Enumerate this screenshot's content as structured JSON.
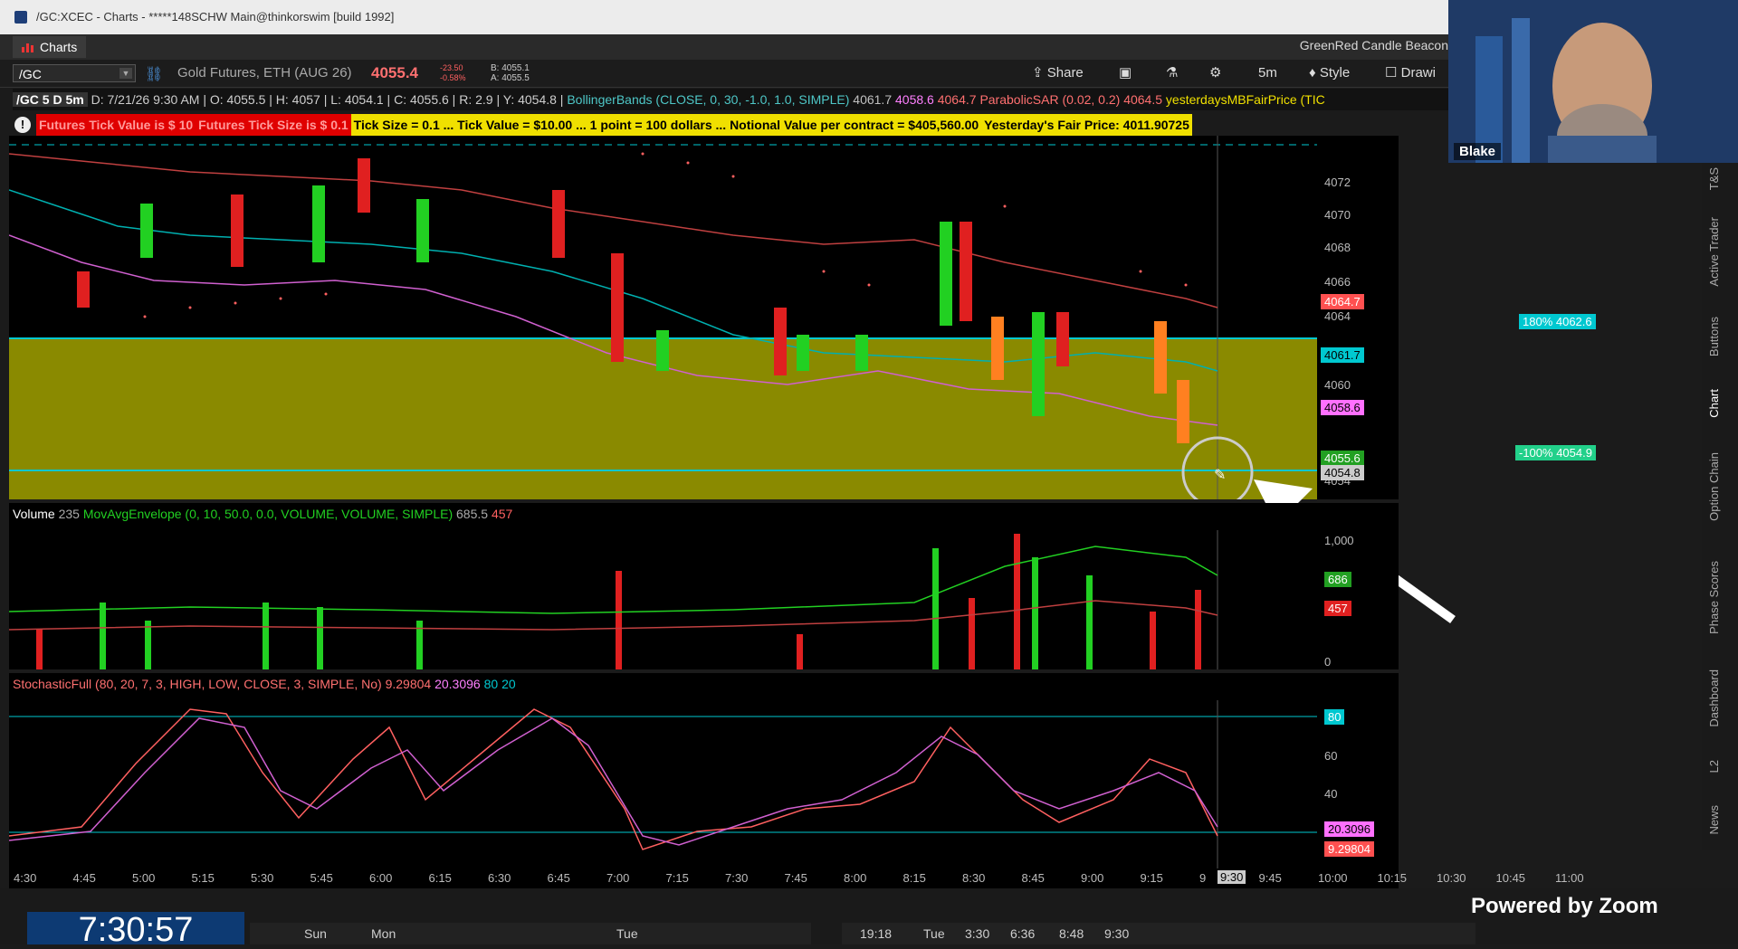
{
  "window": {
    "title": "/GC:XCEC - Charts - *****148SCHW Main@thinkorswim [build 1992]"
  },
  "tabs": {
    "charts_label": "Charts",
    "beacon_label": "GreenRed Candle Beacon"
  },
  "toolbar": {
    "symbol": "/GC",
    "description": "Gold Futures, ETH (AUG 26)",
    "last_price": "4055.4",
    "change": "-23.50",
    "change_pct": "-0.58%",
    "bid": "B: 4055.1",
    "ask": "A: 4055.5",
    "share_label": "Share",
    "timeframe": "5m",
    "style_label": "Style",
    "drawings_label": "Drawi"
  },
  "infobar": {
    "chart_id": "/GC 5 D 5m",
    "date": "D: 7/21/26 9:30 AM",
    "open": "O: 4055.5",
    "high": "H: 4057",
    "low": "L: 4054.1",
    "close": "C: 4055.6",
    "range": "R: 2.9",
    "y": "Y: 4054.8",
    "bollinger": "BollingerBands (CLOSE, 0, 30, -1.0, 1.0, SIMPLE)",
    "bb_upper": "4061.7",
    "bb_mid": "4058.6",
    "bb_lower": "4064.7",
    "sar": "ParabolicSAR (0.02, 0.2)",
    "sar_val": "4064.5",
    "fair": "yesterdaysMBFairPrice (TIC"
  },
  "warnings": {
    "w1": "Futures Tick Value is $ 10",
    "w2": "Futures Tick Size is $ 0.1",
    "w3": "Tick Size = 0.1 ... Tick Value = $10.00 ... 1 point = 100 dollars ... Notional Value per contract = $405,560.00",
    "w4": "Yesterday's Fair Price: 4011.90725"
  },
  "price_axis": {
    "ticks": [
      "4072",
      "4070",
      "4068",
      "4066",
      "4064",
      "4062",
      "4060",
      "4058",
      "4056",
      "4054"
    ],
    "tag_upper_pct": "180% 4062.6",
    "tag_lower_pct": "-100% 4054.9",
    "tag_4064": "4064.7",
    "tag_4061": "4061.7",
    "tag_4058": "4058.6",
    "tag_4055": "4055.6",
    "tag_4054": "4054.8"
  },
  "volume": {
    "label": "Volume",
    "value": "235",
    "study": "MovAvgEnvelope (0, 10, 50.0, 0.0, VOLUME, VOLUME, SIMPLE)",
    "upper": "685.5",
    "lower": "457",
    "axis_top": "1,000",
    "axis_zero": "0",
    "tag_green": "686",
    "tag_red": "457"
  },
  "stochastic": {
    "study": "StochasticFull (80, 20, 7, 3, HIGH, LOW, CLOSE, 3, SIMPLE, No)",
    "k": "9.29804",
    "d": "20.3096",
    "ob": "80",
    "os": "20",
    "axis": [
      "80",
      "60",
      "40"
    ],
    "tag_d": "20.3096",
    "tag_k": "9.29804"
  },
  "time_axis": {
    "labels": [
      "4:30",
      "4:45",
      "5:00",
      "5:15",
      "5:30",
      "5:45",
      "6:00",
      "6:15",
      "6:30",
      "6:45",
      "7:00",
      "7:15",
      "7:30",
      "7:45",
      "8:00",
      "8:15",
      "8:30",
      "8:45",
      "9:00",
      "9:15",
      "9",
      "9:45",
      "10:00",
      "10:15",
      "10:30",
      "10:45",
      "11:00"
    ],
    "cursor": "9:30"
  },
  "side_tabs": [
    "T&S",
    "Active Trader",
    "Buttons",
    "Chart",
    "Option Chain",
    "Phase Scores",
    "Dashboard",
    "L2",
    "News"
  ],
  "bottom": {
    "clock": "7:30:57",
    "days": [
      "Sun",
      "Mon",
      "Tue"
    ],
    "times": [
      "19:18",
      "Tue",
      "3:30",
      "6:36",
      "8:48",
      "9:30"
    ]
  },
  "video": {
    "name": "Blake"
  },
  "zoom_badge": "Powered by Zoom",
  "colors": {
    "up": "#22d022",
    "down": "#e02020",
    "zone": "#8a8a00",
    "cyan": "#00c8d0",
    "warn_red": "#e00000",
    "warn_yellow": "#f0e000"
  }
}
